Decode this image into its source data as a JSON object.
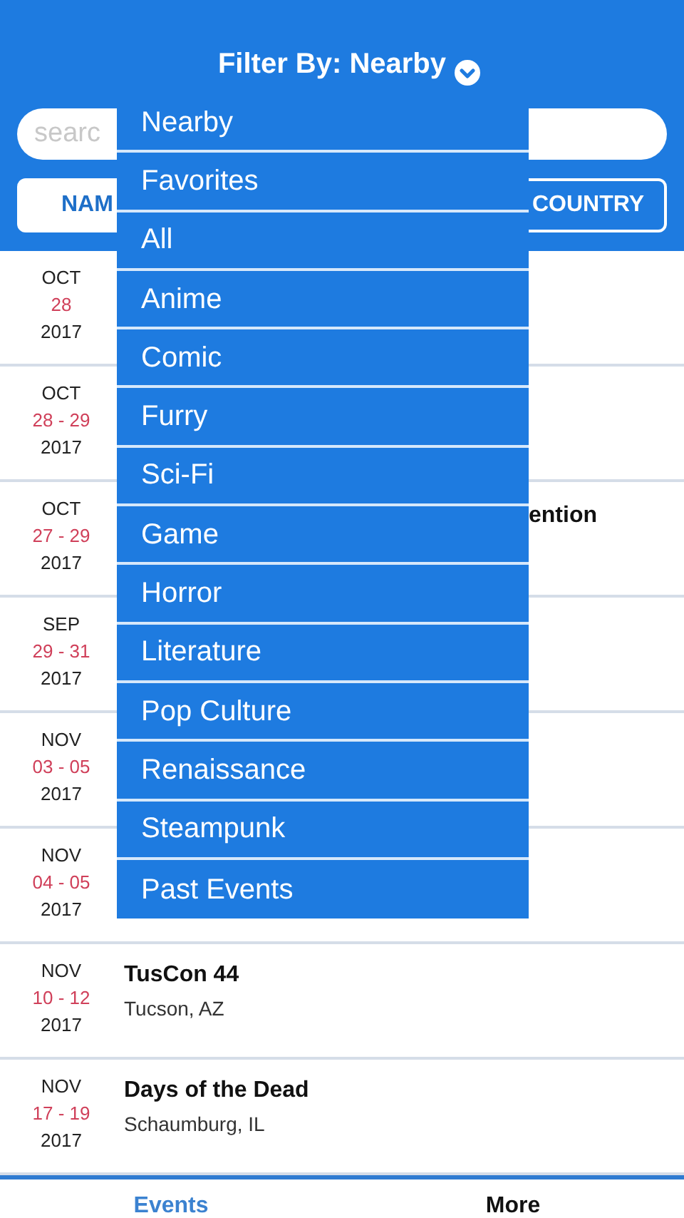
{
  "header": {
    "title": "Filter By: Nearby"
  },
  "search": {
    "placeholder": "searc"
  },
  "sort_buttons": [
    {
      "label": "NAM",
      "selected": true
    },
    {
      "label": "COUNTRY",
      "selected": false
    }
  ],
  "filter_menu": [
    {
      "label": "Nearby"
    },
    {
      "label": "Favorites"
    },
    {
      "label": "All"
    },
    {
      "label": "Anime"
    },
    {
      "label": "Comic"
    },
    {
      "label": "Furry"
    },
    {
      "label": "Sci-Fi"
    },
    {
      "label": "Game"
    },
    {
      "label": "Horror"
    },
    {
      "label": "Literature"
    },
    {
      "label": "Pop Culture"
    },
    {
      "label": "Renaissance"
    },
    {
      "label": "Steampunk"
    },
    {
      "label": "Past Events"
    }
  ],
  "events": [
    {
      "kind": "covered",
      "month": "OCT",
      "days": "28",
      "year": "2017"
    },
    {
      "kind": "covered",
      "month": "OCT",
      "days": "28 - 29",
      "year": "2017"
    },
    {
      "kind": "partial",
      "month": "OCT",
      "days": "27 - 29",
      "year": "2017",
      "title": "ention"
    },
    {
      "kind": "covered",
      "month": "SEP",
      "days": "29 - 31",
      "year": "2017"
    },
    {
      "kind": "covered",
      "month": "NOV",
      "days": "03 - 05",
      "year": "2017"
    },
    {
      "kind": "covered",
      "month": "NOV",
      "days": "04 - 05",
      "year": "2017"
    },
    {
      "kind": "full",
      "month": "NOV",
      "days": "10 - 12",
      "year": "2017",
      "title": "TusCon 44",
      "location": "Tucson, AZ"
    },
    {
      "kind": "full",
      "month": "NOV",
      "days": "17 - 19",
      "year": "2017",
      "title": "Days of the Dead",
      "location": "Schaumburg, IL"
    }
  ],
  "tab_bar": [
    {
      "label": "Events",
      "selected": true
    },
    {
      "label": "More",
      "selected": false
    }
  ]
}
